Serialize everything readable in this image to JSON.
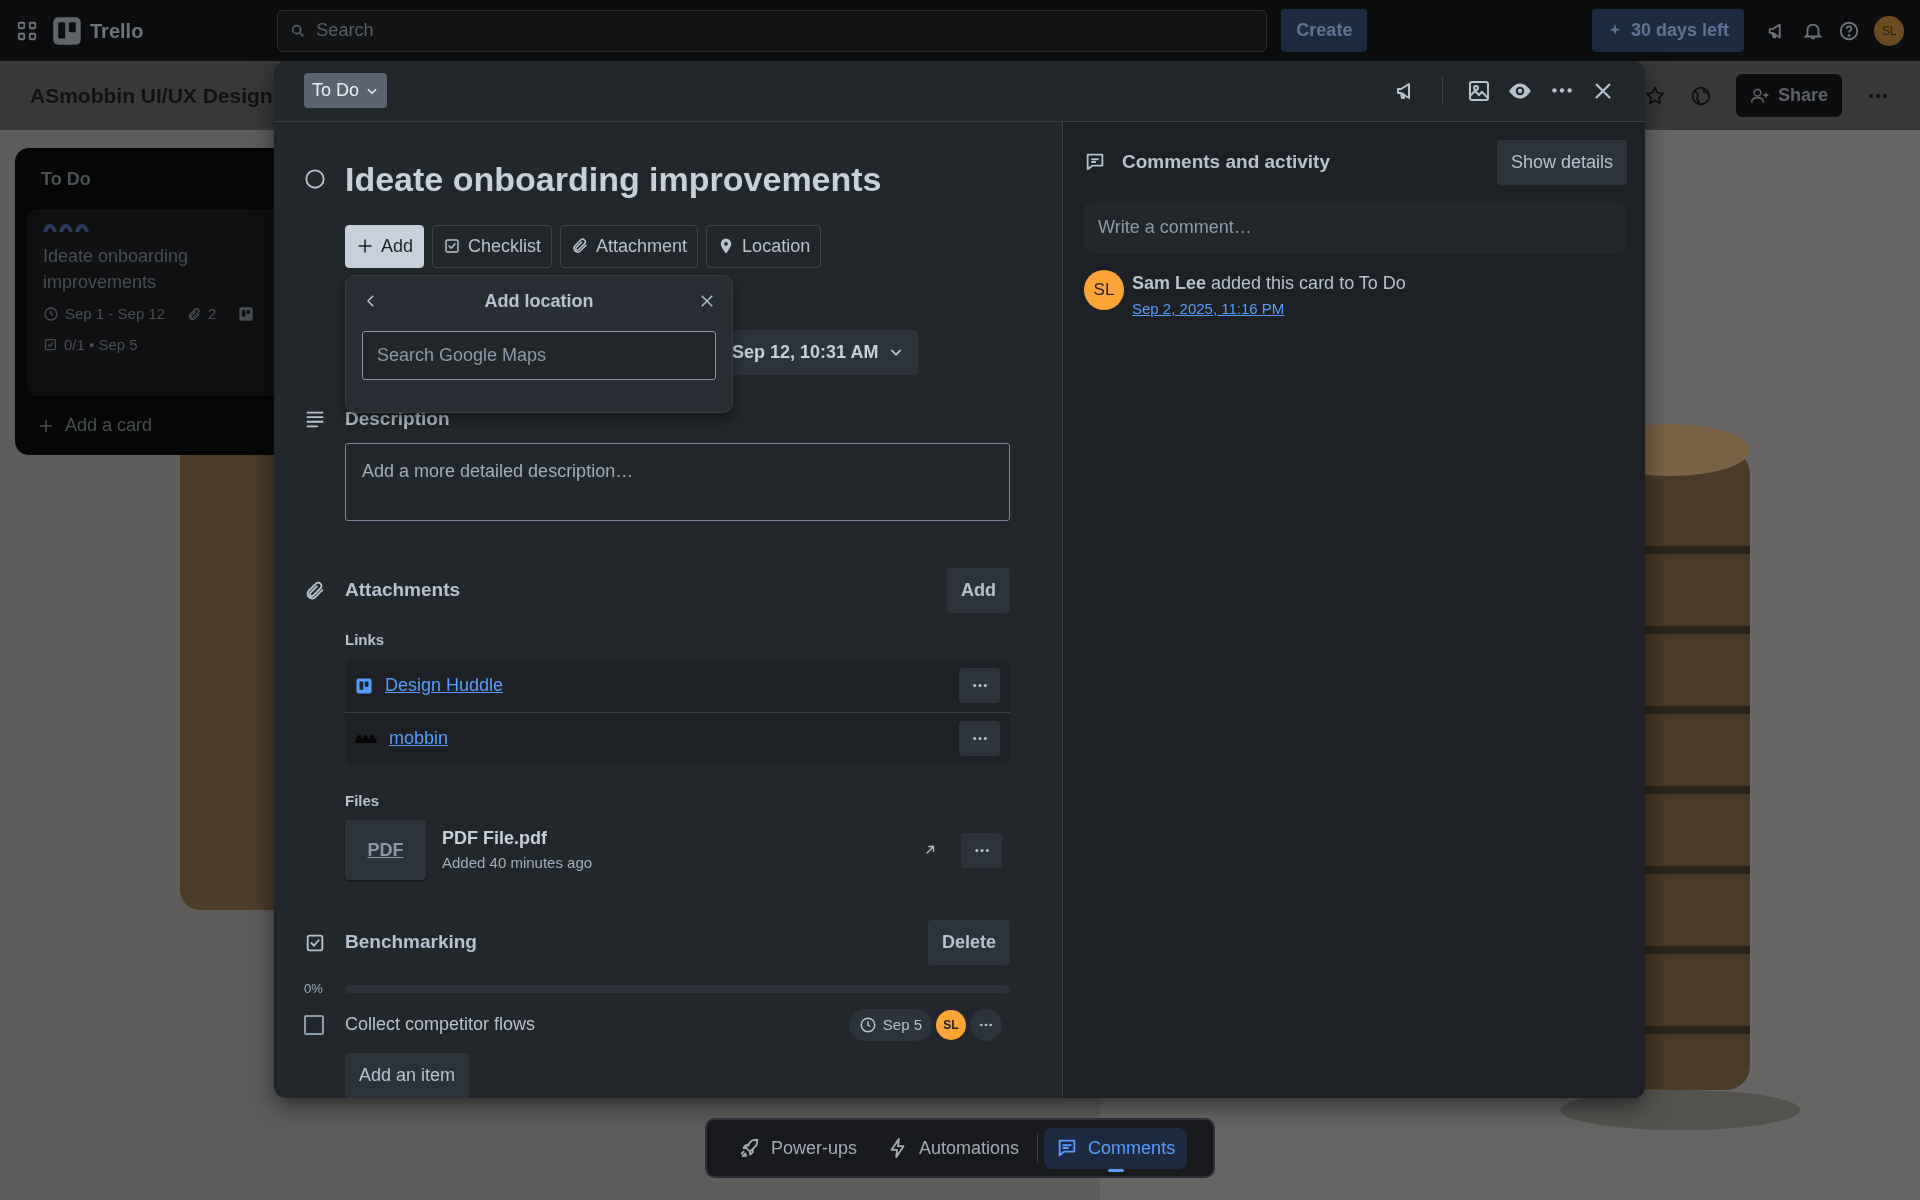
{
  "top_bar": {
    "app_name": "Trello",
    "search": {
      "placeholder": "Search"
    },
    "create_button": "Create",
    "trial_button": "30 days left",
    "avatar": "SL"
  },
  "board": {
    "title": "ASmobbin UI/UX Design",
    "share_button": "Share",
    "lists": [
      {
        "title": "To Do",
        "cards": [
          {
            "title": "Ideate onboarding improvements",
            "dates": "Sep 1 - Sep 12",
            "attachments": "2",
            "checklist": "0/1 • Sep 5"
          }
        ],
        "add_card": "Add a card"
      }
    ]
  },
  "card_modal": {
    "list_button": "To Do",
    "title": "Ideate onboarding improvements",
    "completed": false,
    "actions": [
      {
        "label": "Add",
        "selected": true
      },
      {
        "label": "Checklist",
        "selected": false
      },
      {
        "label": "Attachment",
        "selected": false
      },
      {
        "label": "Location",
        "selected": false
      }
    ],
    "popover": {
      "title": "Add location",
      "search": {
        "placeholder": "Search Google Maps"
      }
    },
    "dates": "Sep 12, 10:31 AM",
    "description": {
      "heading": "Description",
      "placeholder": "Add a more detailed description…"
    },
    "attachments": {
      "heading": "Attachments",
      "add_button": "Add",
      "links_label": "Links",
      "links": [
        {
          "title": "Design Huddle",
          "kind": "board"
        },
        {
          "title": "mobbin",
          "kind": "site"
        }
      ],
      "files_label": "Files",
      "files": [
        {
          "thumb": "PDF",
          "name": "PDF File.pdf",
          "added": "Added 40 minutes ago"
        }
      ]
    },
    "checklist": {
      "title": "Benchmarking",
      "delete_button": "Delete",
      "percent": "0%",
      "level": 0,
      "items": [
        {
          "text": "Collect competitor flows",
          "checked": false,
          "due": "Sep 5",
          "assignee": "SL"
        }
      ],
      "add_item": "Add an item"
    },
    "activity": {
      "heading": "Comments and activity",
      "details_button": "Show details",
      "comment": {
        "placeholder": "Write a comment…"
      },
      "entries": [
        {
          "avatar": "SL",
          "text": "**Sam Lee** added this card to To Do",
          "time": "Sep 2, 2025, 11:16 PM"
        }
      ]
    }
  },
  "bottom_bar": [
    {
      "label": "Power-ups",
      "selected": false
    },
    {
      "label": "Automations",
      "selected": false
    },
    {
      "label": "Comments",
      "selected": true
    }
  ]
}
